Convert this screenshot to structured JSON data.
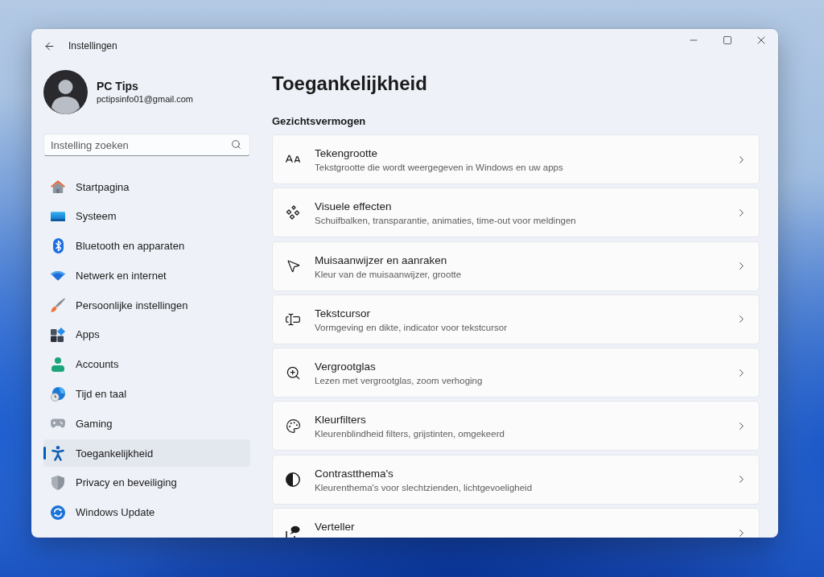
{
  "window": {
    "title": "Instellingen"
  },
  "profile": {
    "name": "PC Tips",
    "email": "pctipsinfo01@gmail.com"
  },
  "search": {
    "placeholder": "Instelling zoeken"
  },
  "sidebar": {
    "items": [
      {
        "kind": "home",
        "label": "Startpagina",
        "selected": false
      },
      {
        "kind": "system",
        "label": "Systeem",
        "selected": false
      },
      {
        "kind": "bluetooth",
        "label": "Bluetooth en apparaten",
        "selected": false
      },
      {
        "kind": "network",
        "label": "Netwerk en internet",
        "selected": false
      },
      {
        "kind": "personalization",
        "label": "Persoonlijke instellingen",
        "selected": false
      },
      {
        "kind": "apps",
        "label": "Apps",
        "selected": false
      },
      {
        "kind": "accounts",
        "label": "Accounts",
        "selected": false
      },
      {
        "kind": "time",
        "label": "Tijd en taal",
        "selected": false
      },
      {
        "kind": "gaming",
        "label": "Gaming",
        "selected": false
      },
      {
        "kind": "accessibility",
        "label": "Toegankelijkheid",
        "selected": true
      },
      {
        "kind": "privacy",
        "label": "Privacy en beveiliging",
        "selected": false
      },
      {
        "kind": "update",
        "label": "Windows Update",
        "selected": false
      }
    ]
  },
  "page": {
    "title": "Toegankelijkheid",
    "section": "Gezichtsvermogen",
    "items": [
      {
        "kind": "text-size",
        "title": "Tekengrootte",
        "subtitle": "Tekstgrootte die wordt weergegeven in Windows en uw apps"
      },
      {
        "kind": "visual-effects",
        "title": "Visuele effecten",
        "subtitle": "Schuifbalken, transparantie, animaties, time-out voor meldingen"
      },
      {
        "kind": "mouse-pointer",
        "title": "Muisaanwijzer en aanraken",
        "subtitle": "Kleur van de muisaanwijzer, grootte"
      },
      {
        "kind": "text-cursor",
        "title": "Tekstcursor",
        "subtitle": "Vormgeving en dikte, indicator voor tekstcursor"
      },
      {
        "kind": "magnifier",
        "title": "Vergrootglas",
        "subtitle": "Lezen met vergrootglas, zoom verhoging"
      },
      {
        "kind": "color-filters",
        "title": "Kleurfilters",
        "subtitle": "Kleurenblindheid filters, grijstinten, omgekeerd"
      },
      {
        "kind": "contrast",
        "title": "Contrastthema's",
        "subtitle": "Kleurenthema's voor slechtzienden, lichtgevoeligheid"
      },
      {
        "kind": "narrator",
        "title": "Verteller"
      }
    ]
  }
}
